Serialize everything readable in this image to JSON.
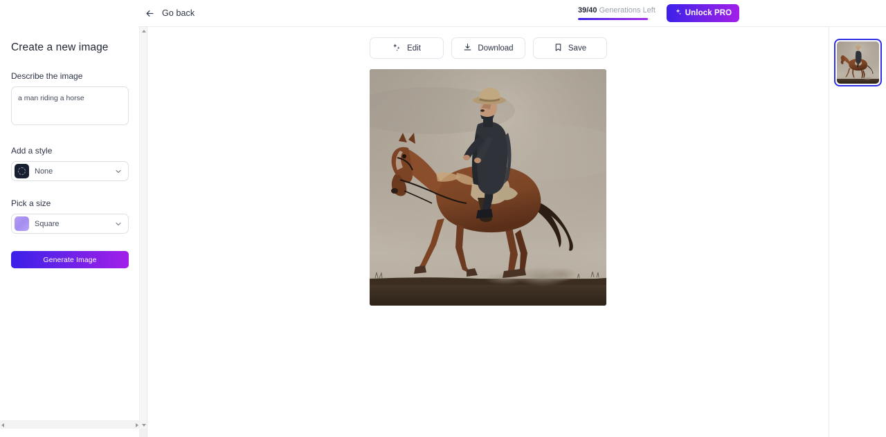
{
  "header": {
    "back_label": "Go back",
    "back_icon": "arrow-left-icon",
    "generations": {
      "count_text": "39/40",
      "label_text": " Generations Left",
      "used": 39,
      "total": 40,
      "percent": 97.5
    },
    "unlock_button": {
      "label": "Unlock PRO",
      "icon": "sparkles-icon"
    }
  },
  "sidebar": {
    "title": "Create a new image",
    "prompt": {
      "label": "Describe the image",
      "value": "a man riding a horse",
      "placeholder": "Describe the image"
    },
    "style": {
      "label": "Add a style",
      "selected": "None",
      "swatch_icon": "dashed-circle-icon",
      "chevron_icon": "chevron-down-icon"
    },
    "size": {
      "label": "Pick a size",
      "selected": "Square",
      "swatch_color": "#a48df0",
      "chevron_icon": "chevron-down-icon"
    },
    "generate_button": {
      "label": "Generate Image"
    }
  },
  "main": {
    "actions": [
      {
        "label": "Edit",
        "icon": "magic-wand-icon"
      },
      {
        "label": "Download",
        "icon": "download-icon"
      },
      {
        "label": "Save",
        "icon": "bookmark-icon"
      }
    ],
    "image": {
      "alt": "a man riding a horse",
      "aspect": "Square"
    }
  },
  "rail": {
    "thumbnails": [
      {
        "alt": "a man riding a horse",
        "selected": true
      }
    ],
    "selected_border_color": "#2f2fe8"
  },
  "colors": {
    "accent_start": "#3b20e8",
    "accent_end": "#a21fe8",
    "text_primary": "#1f2533",
    "text_muted": "#9aa0ae",
    "border": "#e3e5ec"
  }
}
